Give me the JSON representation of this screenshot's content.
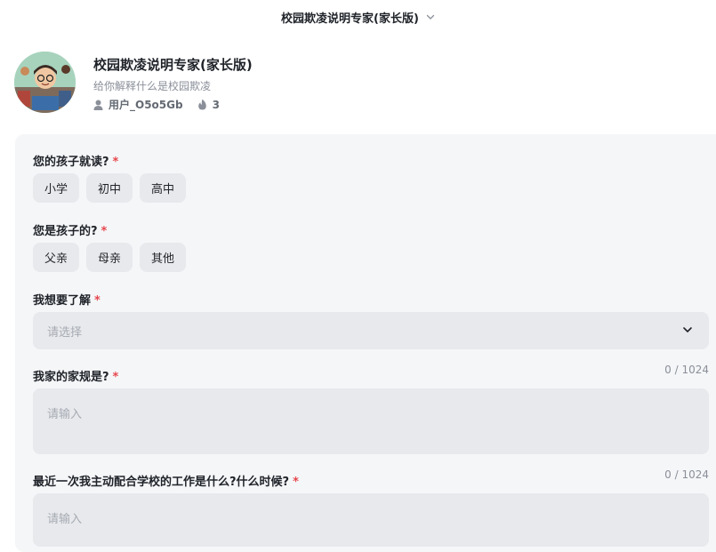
{
  "topbar": {
    "title": "校园欺凌说明专家(家长版)"
  },
  "bot": {
    "name": "校园欺凌说明专家(家长版)",
    "description": "给你解释什么是校园欺凌",
    "author": "用户_O5o5Gb",
    "popularity": "3"
  },
  "form": {
    "q1": {
      "label": "您的孩子就读?",
      "required": "*",
      "options": [
        "小学",
        "初中",
        "高中"
      ]
    },
    "q2": {
      "label": "您是孩子的?",
      "required": "*",
      "options": [
        "父亲",
        "母亲",
        "其他"
      ]
    },
    "q3": {
      "label": "我想要了解",
      "required": "*",
      "placeholder": "请选择"
    },
    "q4": {
      "label": "我家的家规是?",
      "required": "*",
      "counter": "0 / 1024",
      "placeholder": "请输入"
    },
    "q5": {
      "label": "最近一次我主动配合学校的工作是什么?什么时候?",
      "required": "*",
      "counter": "0 / 1024",
      "placeholder": "请输入"
    }
  },
  "colors": {
    "required_star": "#e5484d",
    "panel_bg": "#f5f6f8",
    "chip_bg": "#e8e9ec"
  },
  "icons": {
    "topbar": "chevron-down-icon",
    "author": "user-icon",
    "popularity": "flame-icon",
    "select": "chevron-down-icon"
  }
}
